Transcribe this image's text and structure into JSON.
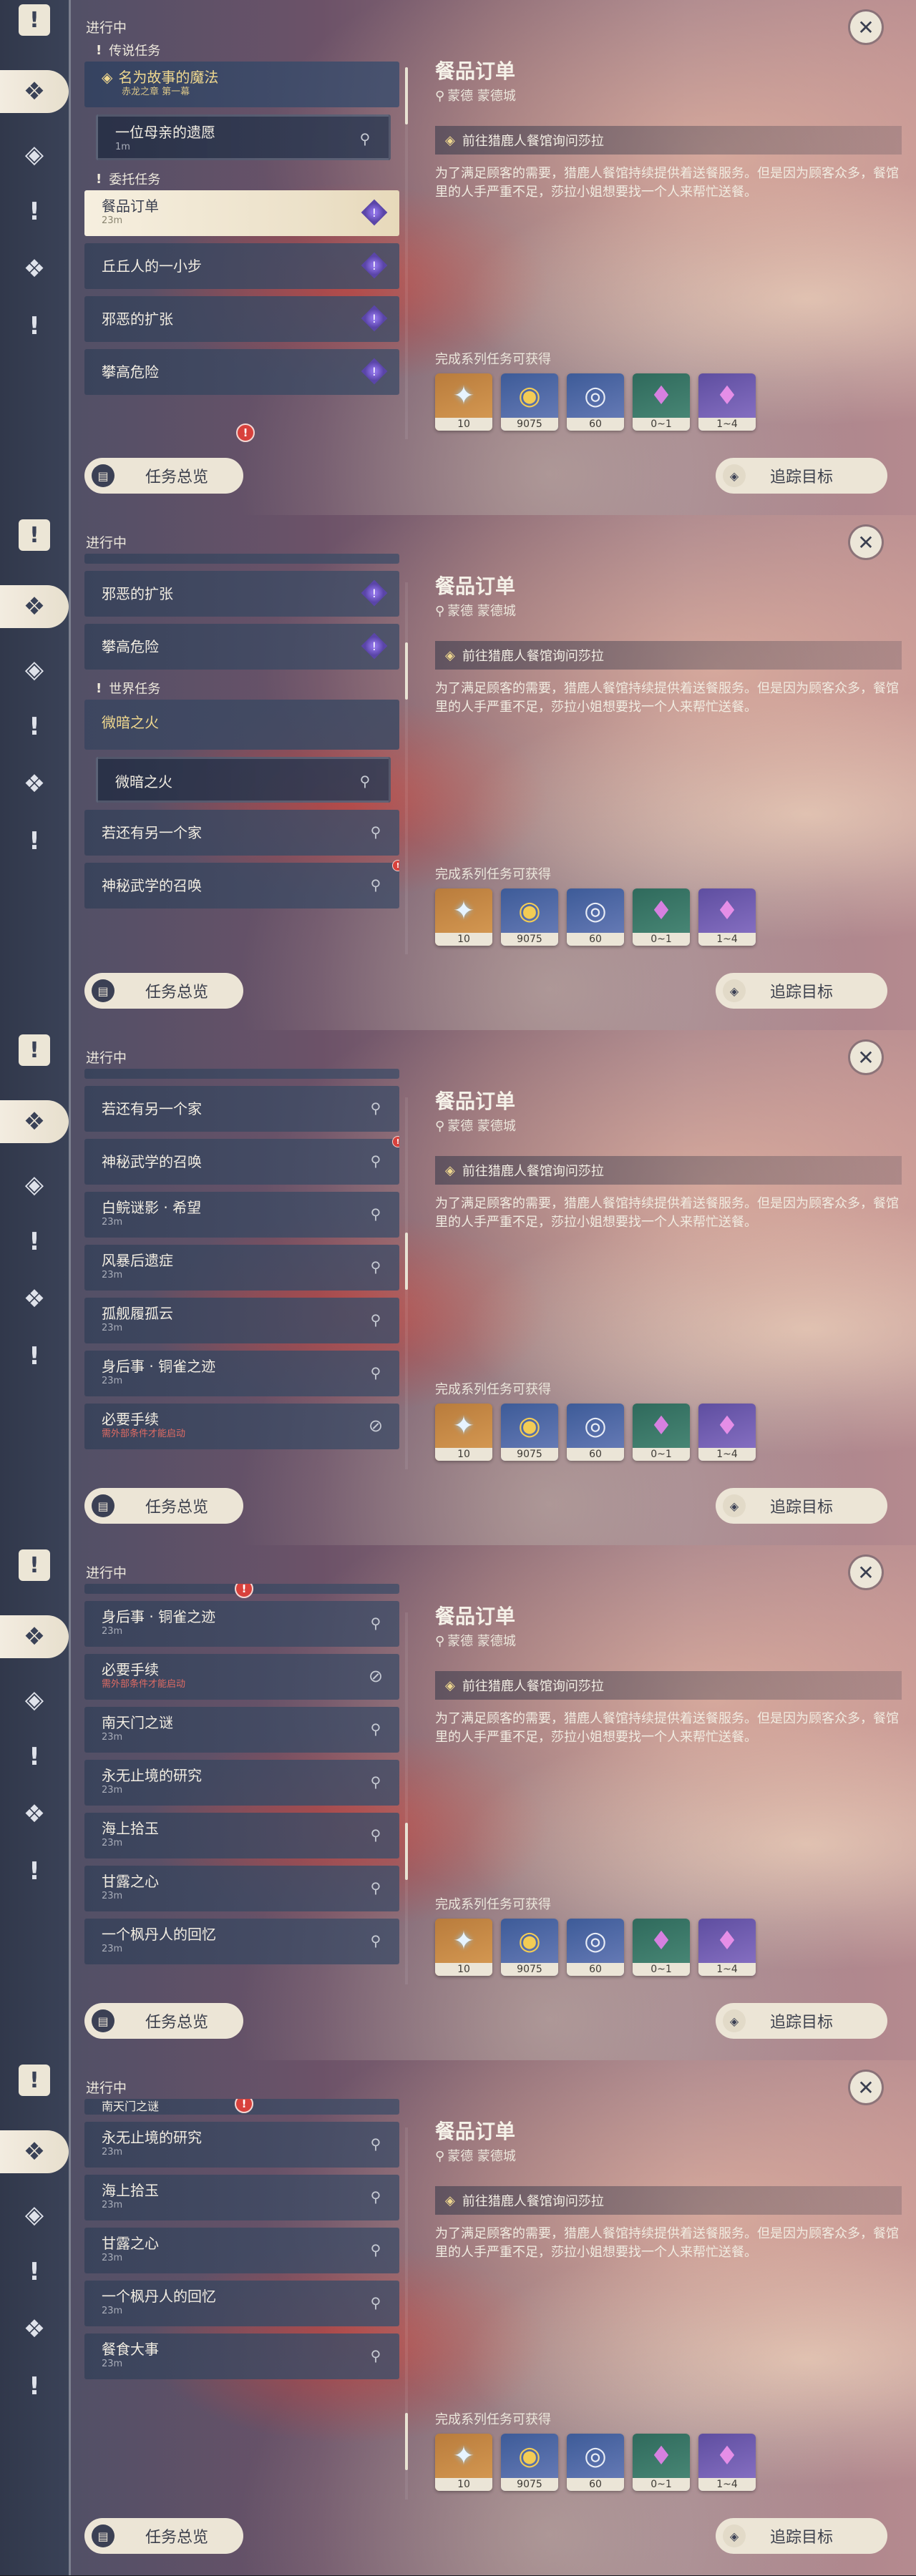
{
  "ui": {
    "in_progress": "进行中",
    "quest_overview": "任务总览",
    "track_target": "追踪目标",
    "close_symbol": "✕"
  },
  "rail_icons": [
    "quest-book-icon",
    "all-quests-icon",
    "archon-quest-icon",
    "story-quest-icon",
    "world-quest-icon",
    "event-quest-icon"
  ],
  "detail": {
    "title": "餐品订单",
    "location": "蒙德 蒙德城",
    "goal": "前往猎鹿人餐馆询问莎拉",
    "description": "为了满足顾客的需要，猎鹿人餐馆持续提供着送餐服务。但是因为顾客众多，餐馆里的人手严重不足，莎拉小姐想要找一个人来帮忙送餐。",
    "rewards_label": "完成系列任务可获得",
    "rewards": [
      {
        "name": "primogem",
        "icon": "✦",
        "count": "10",
        "rarity": "gold"
      },
      {
        "name": "mora",
        "icon": "◉",
        "count": "9075",
        "rarity": "blue"
      },
      {
        "name": "adventure-exp",
        "icon": "◎",
        "count": "60",
        "rarity": "blue"
      },
      {
        "name": "crystal-green",
        "icon": "♦",
        "count": "0~1",
        "rarity": "green"
      },
      {
        "name": "crystal-purple",
        "icon": "♦",
        "count": "1~4",
        "rarity": "purple"
      }
    ]
  },
  "screens": [
    {
      "items": [
        {
          "kind": "section",
          "label": "传说任务"
        },
        {
          "kind": "legend",
          "name": "名为故事的魔法",
          "sub": "赤龙之章 第一幕"
        },
        {
          "kind": "child",
          "name": "一位母亲的遗愿",
          "sub": "1m",
          "right": "pin"
        },
        {
          "kind": "section",
          "label": "委托任务"
        },
        {
          "kind": "quest",
          "name": "餐品订单",
          "sub": "23m",
          "right": "purple",
          "selected": true
        },
        {
          "kind": "quest",
          "name": "丘丘人的一小步",
          "sub": "",
          "right": "purple"
        },
        {
          "kind": "quest",
          "name": "邪恶的扩张",
          "sub": "",
          "right": "purple"
        },
        {
          "kind": "quest",
          "name": "攀高危险",
          "sub": "",
          "right": "purple"
        }
      ]
    },
    {
      "items": [
        {
          "kind": "partial"
        },
        {
          "kind": "quest",
          "name": "邪恶的扩张",
          "sub": "",
          "right": "purple"
        },
        {
          "kind": "quest",
          "name": "攀高危险",
          "sub": "",
          "right": "purple"
        },
        {
          "kind": "section",
          "label": "世界任务"
        },
        {
          "kind": "world",
          "name": "微暗之火",
          "sub": ""
        },
        {
          "kind": "child",
          "name": "微暗之火",
          "sub": "",
          "right": "pin"
        },
        {
          "kind": "quest",
          "name": "若还有另一个家",
          "sub": "",
          "right": "pin"
        },
        {
          "kind": "quest",
          "name": "神秘武学的召唤",
          "sub": "",
          "right": "pin",
          "notice": true
        }
      ]
    },
    {
      "items": [
        {
          "kind": "partial"
        },
        {
          "kind": "quest",
          "name": "若还有另一个家",
          "sub": "",
          "right": "pin"
        },
        {
          "kind": "quest",
          "name": "神秘武学的召唤",
          "sub": "",
          "right": "pin",
          "notice": true
        },
        {
          "kind": "quest",
          "name": "白鲩谜影 · 希望",
          "sub": "23m",
          "right": "pin"
        },
        {
          "kind": "quest",
          "name": "风暴后遗症",
          "sub": "23m",
          "right": "pin"
        },
        {
          "kind": "quest",
          "name": "孤舰履孤云",
          "sub": "23m",
          "right": "pin"
        },
        {
          "kind": "quest",
          "name": "身后事 · 铜雀之迹",
          "sub": "23m",
          "right": "pin"
        },
        {
          "kind": "quest",
          "name": "必要手续",
          "sub": "需外部条件才能启动",
          "red": true,
          "right": "ban"
        }
      ]
    },
    {
      "items": [
        {
          "kind": "partial",
          "notice": true
        },
        {
          "kind": "quest",
          "name": "身后事 · 铜雀之迹",
          "sub": "23m",
          "right": "pin"
        },
        {
          "kind": "quest",
          "name": "必要手续",
          "sub": "需外部条件才能启动",
          "red": true,
          "right": "ban"
        },
        {
          "kind": "quest",
          "name": "南天门之谜",
          "sub": "23m",
          "right": "pin"
        },
        {
          "kind": "quest",
          "name": "永无止境的研究",
          "sub": "23m",
          "right": "pin"
        },
        {
          "kind": "quest",
          "name": "海上拾玉",
          "sub": "23m",
          "right": "pin"
        },
        {
          "kind": "quest",
          "name": "甘露之心",
          "sub": "23m",
          "right": "pin"
        },
        {
          "kind": "quest",
          "name": "一个枫丹人的回忆",
          "sub": "23m",
          "right": "pin"
        }
      ]
    },
    {
      "items": [
        {
          "kind": "partial",
          "notice": true,
          "name": "南天门之谜"
        },
        {
          "kind": "quest",
          "name": "永无止境的研究",
          "sub": "23m",
          "right": "pin"
        },
        {
          "kind": "quest",
          "name": "海上拾玉",
          "sub": "23m",
          "right": "pin"
        },
        {
          "kind": "quest",
          "name": "甘露之心",
          "sub": "23m",
          "right": "pin"
        },
        {
          "kind": "quest",
          "name": "一个枫丹人的回忆",
          "sub": "23m",
          "right": "pin"
        },
        {
          "kind": "quest",
          "name": "餐食大事",
          "sub": "23m",
          "right": "pin"
        }
      ]
    }
  ],
  "scroll_position": [
    0.0,
    0.2,
    0.45,
    0.7,
    0.95
  ]
}
